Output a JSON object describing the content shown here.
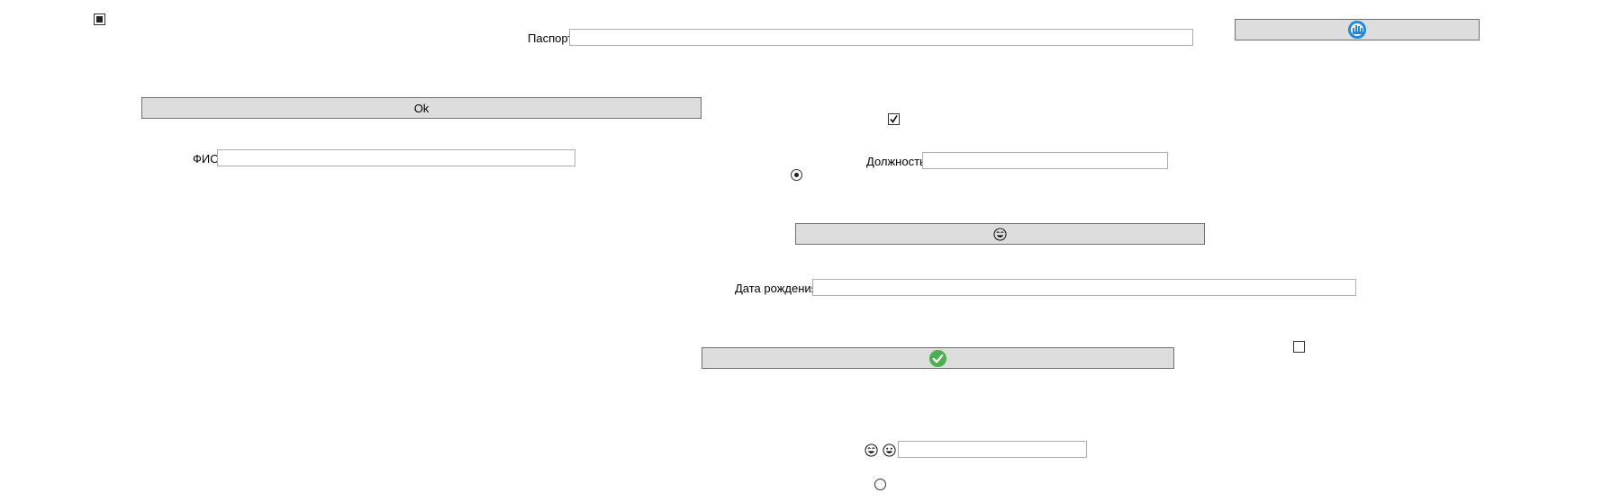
{
  "form": {
    "passport_label": "Паспорт",
    "passport_value": "",
    "fio_label": "ФИО",
    "fio_value": "",
    "position_label": "Должность",
    "position_value": "",
    "birthdate_label": "Дата рождения",
    "birthdate_value": "",
    "emoji_field_value": ""
  },
  "buttons": {
    "ok_label": "Ok",
    "brand_button_icon": "blue-hand-icon",
    "laugh_button_icon": "laughing-face-icon",
    "confirm_button_icon": "green-checkmark-icon"
  },
  "checkboxes": {
    "top_left_state": "indeterminate",
    "middle_state": "checked",
    "right_state": "unchecked"
  },
  "radios": {
    "middle_state": "selected",
    "bottom_state": "unselected"
  },
  "colors": {
    "button_bg": "#dddddd",
    "button_border": "#707070",
    "input_border": "#adadad",
    "check_green": "#4caf50",
    "brand_blue": "#1e88e5"
  }
}
